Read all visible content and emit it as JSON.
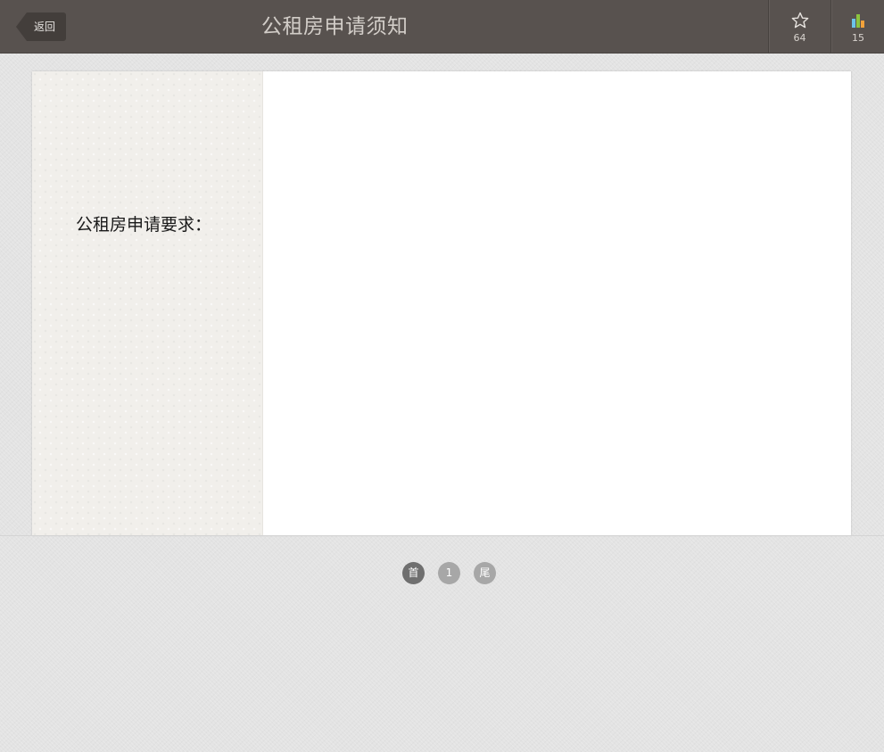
{
  "header": {
    "back_label": "返回",
    "title": "公租房申请须知",
    "favorite": {
      "icon": "star-icon",
      "count": "64"
    },
    "stats": {
      "icon": "bar-chart-icon",
      "count": "15",
      "colors": [
        "#6cc3e8",
        "#8cc43f",
        "#f2a23a"
      ]
    }
  },
  "content": {
    "section_heading": "公租房申请要求："
  },
  "pagination": {
    "first_label": "首",
    "pages": [
      "1"
    ],
    "last_label": "尾",
    "current": "首"
  },
  "colors": {
    "header_bg": "#58524f",
    "title_text": "#d2cdc8",
    "page_bg": "#e3e3e3",
    "side_panel_bg": "#f1efeb",
    "pager_active": "#6f6f6f",
    "pager_inactive": "#a7a7a7"
  }
}
